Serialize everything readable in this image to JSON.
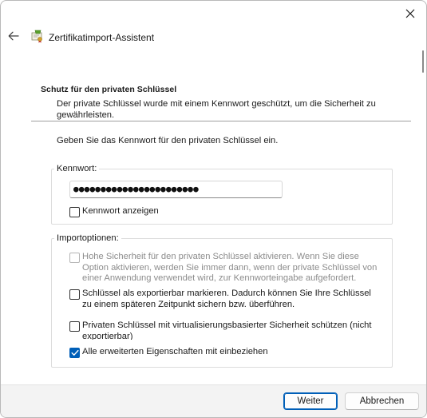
{
  "window": {
    "title": "Zertifikatimport-Assistent",
    "colors": {
      "accent": "#005fb8",
      "border": "#b9b9b9",
      "footer_bg": "#f3f3f3"
    }
  },
  "header": {
    "heading": "Schutz für den privaten Schlüssel",
    "description": "Der private Schlüssel wurde mit einem Kennwort geschützt, um die Sicherheit zu gewährleisten."
  },
  "prompt": "Geben Sie das Kennwort für den privaten Schlüssel ein.",
  "password_group": {
    "legend": "Kennwort:",
    "masked_value": "●●●●●●●●●●●●●●●●●●●●●●●",
    "show_password": {
      "label": "Kennwort anzeigen",
      "checked": false
    }
  },
  "import_options": {
    "legend": "Importoptionen:",
    "high_security": {
      "label": "Hohe Sicherheit für den privaten Schlüssel aktivieren. Wenn Sie diese Option aktivieren, werden Sie immer dann, wenn der private Schlüssel von einer Anwendung verwendet wird, zur Kennworteingabe aufgefordert.",
      "checked": false,
      "disabled": true
    },
    "exportable": {
      "label": "Schlüssel als exportierbar markieren. Dadurch können Sie Ihre Schlüssel zu einem späteren Zeitpunkt sichern bzw. überführen.",
      "checked": false
    },
    "vbs_protect": {
      "label": "Privaten Schlüssel mit virtualisierungsbasierter Sicherheit schützen (nicht exportierbar)",
      "checked": false
    },
    "include_props": {
      "label": "Alle erweiterten Eigenschaften mit einbeziehen",
      "checked": true
    }
  },
  "footer": {
    "next_label": "Weiter",
    "cancel_label": "Abbrechen"
  },
  "icons": {
    "close": "close-icon",
    "back": "back-arrow-icon",
    "app": "certificate-icon",
    "check": "checkmark-icon"
  }
}
